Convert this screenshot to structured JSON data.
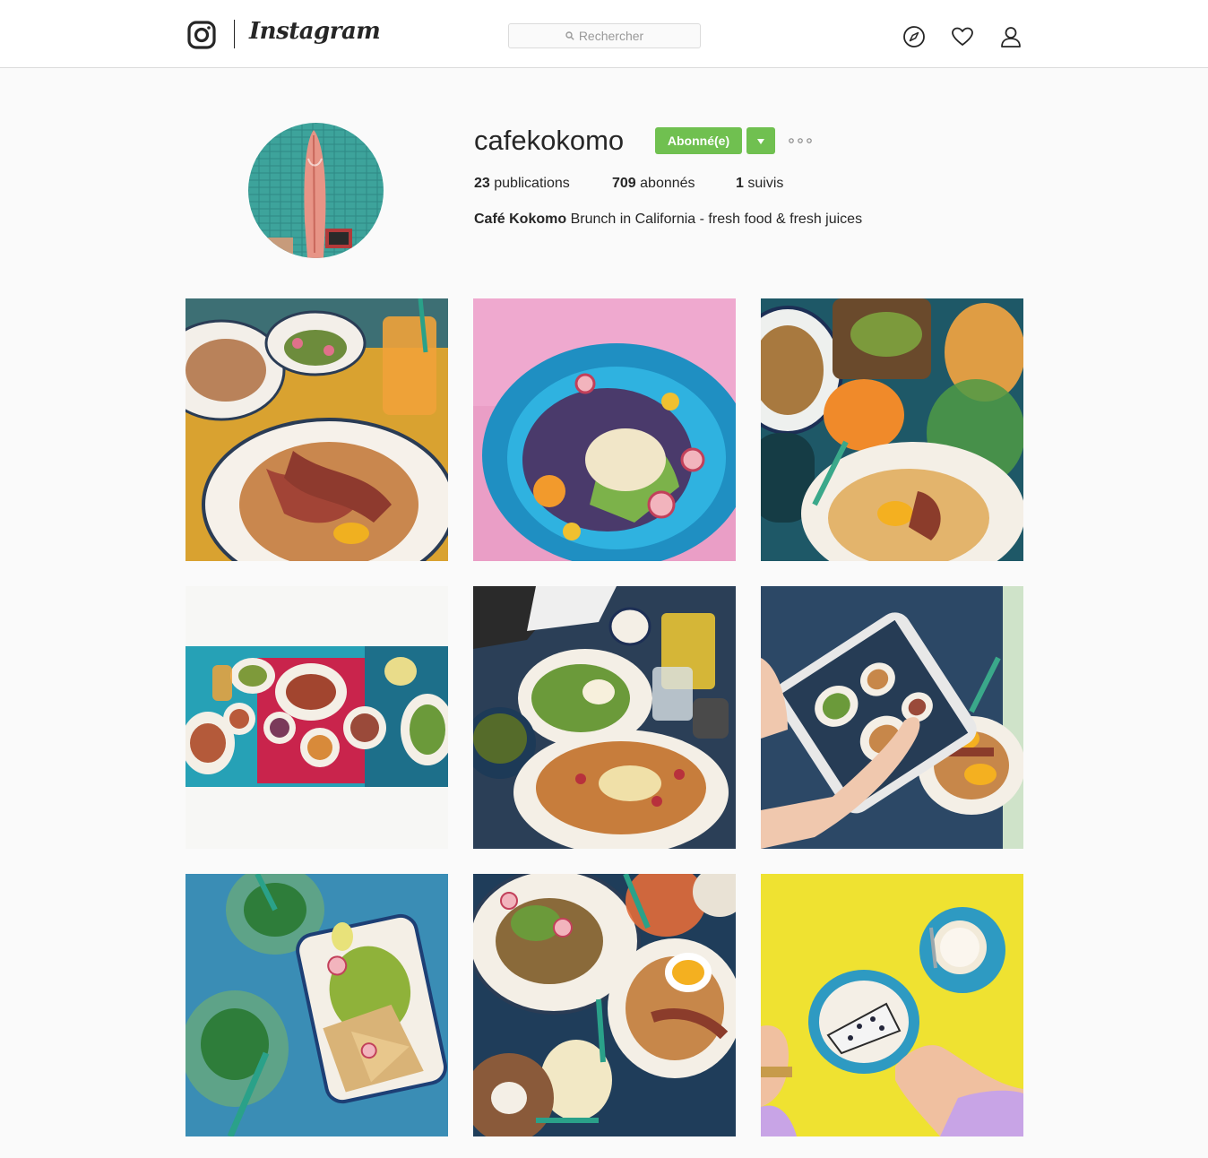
{
  "header": {
    "logo_text": "Instagram",
    "search_placeholder": "Rechercher",
    "icons": [
      "camera-logo-icon",
      "search-icon",
      "compass-icon",
      "heart-icon",
      "person-icon"
    ]
  },
  "profile": {
    "username": "cafekokomo",
    "follow_label": "Abonné(e)",
    "follow_color": "#70c050",
    "stats": {
      "posts_count": "23",
      "posts_label": "publications",
      "followers_count": "709",
      "followers_label": "abonnés",
      "following_count": "1",
      "following_label": "suivis"
    },
    "full_name": "Café Kokomo",
    "bio": "Brunch in California - fresh food & fresh juices"
  },
  "posts": [
    {
      "name": "pancakes-bacon"
    },
    {
      "name": "salad-bowl-pink"
    },
    {
      "name": "brunch-teal-table"
    },
    {
      "name": "table-overhead-landscape"
    },
    {
      "name": "pancakes-tea-dark"
    },
    {
      "name": "phone-photo-brunch"
    },
    {
      "name": "guacamole-mojito"
    },
    {
      "name": "brunch-green-straw"
    },
    {
      "name": "cheesecake-yellow"
    }
  ]
}
